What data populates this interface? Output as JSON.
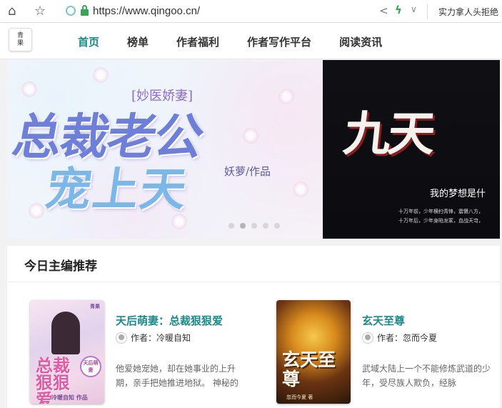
{
  "browser": {
    "url": "https://www.qingoo.cn/",
    "search_text": "实力拿人头拒绝",
    "icons": [
      "home-icon",
      "star-icon",
      "shield-icon",
      "lock-icon",
      "share-icon",
      "bolt-icon",
      "chevron-down-icon"
    ]
  },
  "site": {
    "logo_text": "青果",
    "nav": [
      "首页",
      "榜单",
      "作者福利",
      "作者写作平台",
      "阅读资讯"
    ],
    "active_nav": "首页",
    "accent_color": "#1a8a8a"
  },
  "banner": {
    "slide1": {
      "bracket_title": "[妙医娇妻]",
      "title_line1": "总裁老公",
      "title_line2": "宠上天",
      "author": "妖萝/作品"
    },
    "slide2": {
      "title": "九天",
      "subtitle": "我的梦想是什",
      "line1": "十万年前，少年横扫青锋，震慑八方，",
      "line2": "十万年后，少年身陷龙冢，血战天穹，"
    },
    "dots_total": 5,
    "active_dot": 2
  },
  "recommend": {
    "title": "今日主编推荐",
    "books": [
      {
        "title": "天后萌妻：总裁狠狠爱",
        "author_label": "作者：冷暖自知",
        "description": "他爱她宠她，却在她事业的上升期，亲手把她推进地狱。 神秘的",
        "cover_text": "总裁狠狠爱",
        "cover_badge": "天后萌妻",
        "cover_author": "冷暖自知 作品",
        "cover_brand": "青果"
      },
      {
        "title": "玄天至尊",
        "author_label": "作者：忽而今夏",
        "description": "武域大陆上一个不能修炼武道的少年，受尽族人欺负，经脉",
        "cover_text": "玄天至尊",
        "cover_author": "忽而今夏 著"
      }
    ]
  }
}
